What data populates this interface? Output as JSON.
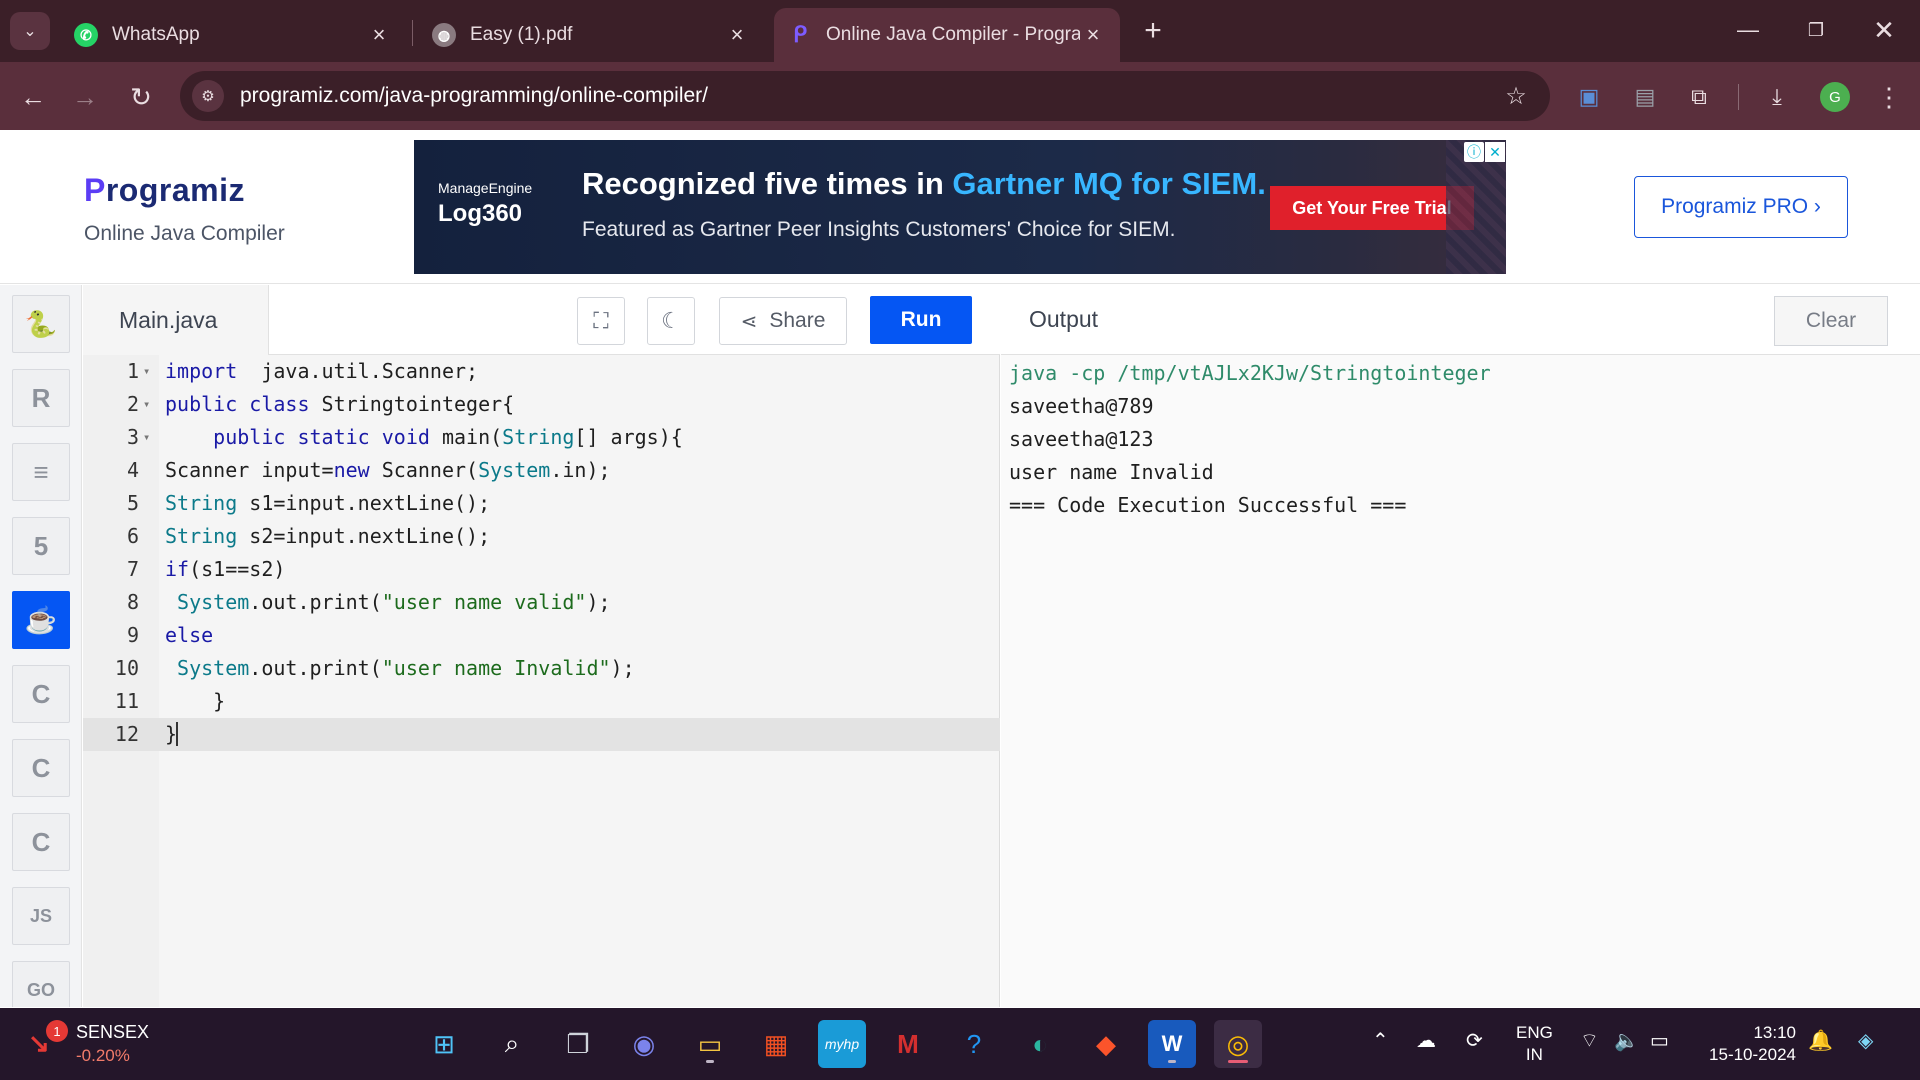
{
  "browser": {
    "tabs": [
      {
        "title": "WhatsApp",
        "icon": "whatsapp-icon"
      },
      {
        "title": "Easy (1).pdf",
        "icon": "globe-icon"
      },
      {
        "title": "Online Java Compiler - Program",
        "icon": "programiz-icon"
      }
    ],
    "active_tab": 2,
    "url": "programiz.com/java-programming/online-compiler/",
    "profile_initial": "G"
  },
  "site": {
    "logo_text": "rogramiz",
    "logo_initial": "P",
    "subtitle": "Online Java Compiler",
    "pro_button": "Programiz PRO ›"
  },
  "ad": {
    "brand_small": "ManageEngine",
    "brand_big": "Log360",
    "headline_prefix": "Recognized five times in ",
    "headline_highlight": "Gartner MQ for SIEM.",
    "subline": "Featured as Gartner Peer Insights Customers' Choice for SIEM.",
    "cta": "Get Your Free Trial"
  },
  "sidebar": {
    "languages": [
      {
        "name": "python",
        "glyph": "🐍"
      },
      {
        "name": "r",
        "glyph": "R"
      },
      {
        "name": "sql",
        "glyph": "≡"
      },
      {
        "name": "html",
        "glyph": "5"
      },
      {
        "name": "java",
        "glyph": "☕"
      },
      {
        "name": "c",
        "glyph": "C"
      },
      {
        "name": "cpp",
        "glyph": "C"
      },
      {
        "name": "csharp",
        "glyph": "C"
      },
      {
        "name": "javascript",
        "glyph": "JS"
      },
      {
        "name": "go",
        "glyph": "GO"
      }
    ],
    "active": "java"
  },
  "editor": {
    "filename": "Main.java",
    "share_label": "Share",
    "run_label": "Run",
    "current_line": 12,
    "lines": [
      {
        "n": "1",
        "fold": true,
        "tokens": [
          [
            "kw",
            "import"
          ],
          [
            "",
            "  java.util.Scanner;"
          ]
        ]
      },
      {
        "n": "2",
        "fold": true,
        "tokens": [
          [
            "kw",
            "public class"
          ],
          [
            "",
            " Stringtointeger{"
          ]
        ]
      },
      {
        "n": "3",
        "fold": true,
        "tokens": [
          [
            "",
            "    "
          ],
          [
            "kw",
            "public static void"
          ],
          [
            "",
            " main("
          ],
          [
            "ty",
            "String"
          ],
          [
            "",
            "[] args){"
          ]
        ]
      },
      {
        "n": "4",
        "fold": false,
        "tokens": [
          [
            "",
            "Scanner input="
          ],
          [
            "kw",
            "new"
          ],
          [
            "",
            " Scanner("
          ],
          [
            "ty",
            "System"
          ],
          [
            "",
            ".in);"
          ]
        ]
      },
      {
        "n": "5",
        "fold": false,
        "tokens": [
          [
            "ty",
            "String"
          ],
          [
            "",
            " s1=input.nextLine();"
          ]
        ]
      },
      {
        "n": "6",
        "fold": false,
        "tokens": [
          [
            "ty",
            "String"
          ],
          [
            "",
            " s2=input.nextLine();"
          ]
        ]
      },
      {
        "n": "7",
        "fold": false,
        "tokens": [
          [
            "kw",
            "if"
          ],
          [
            "",
            "(s1==s2)"
          ]
        ]
      },
      {
        "n": "8",
        "fold": false,
        "tokens": [
          [
            "",
            " "
          ],
          [
            "ty",
            "System"
          ],
          [
            "",
            ".out.print("
          ],
          [
            "str",
            "\"user name valid\""
          ],
          [
            "",
            ");"
          ]
        ]
      },
      {
        "n": "9",
        "fold": false,
        "tokens": [
          [
            "kw",
            "else"
          ]
        ]
      },
      {
        "n": "10",
        "fold": false,
        "tokens": [
          [
            "",
            " "
          ],
          [
            "ty",
            "System"
          ],
          [
            "",
            ".out.print("
          ],
          [
            "str",
            "\"user name Invalid\""
          ],
          [
            "",
            ");"
          ]
        ]
      },
      {
        "n": "11",
        "fold": false,
        "tokens": [
          [
            "",
            "    }"
          ]
        ]
      },
      {
        "n": "12",
        "fold": false,
        "tokens": [
          [
            "",
            "}"
          ]
        ]
      }
    ]
  },
  "output": {
    "title": "Output",
    "clear_label": "Clear",
    "lines": [
      "java -cp /tmp/vtAJLx2KJw/Stringtointeger",
      "saveetha@789",
      "saveetha@123",
      "user name Invalid",
      "=== Code Execution Successful ==="
    ]
  },
  "taskbar": {
    "stock_name": "SENSEX",
    "stock_change": "-0.20%",
    "stock_badge": "1",
    "language": "ENG",
    "region": "IN",
    "time": "13:10",
    "date": "15-10-2024"
  },
  "colors": {
    "accent": "#0556f3",
    "chrome_dark": "#3b1f28",
    "chrome": "#5a2f3c"
  }
}
